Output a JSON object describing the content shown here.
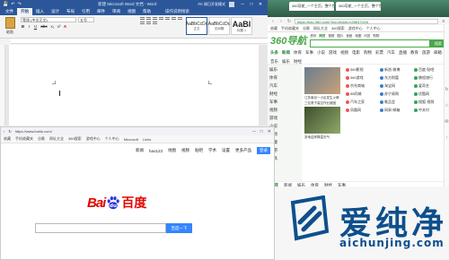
{
  "word": {
    "title": "新建 Microsoft Word 文档 - Word",
    "user": "PE 周日开发模式",
    "quick_access": [
      "💾",
      "↶",
      "↷"
    ],
    "window_controls": [
      "─",
      "□",
      "✕"
    ],
    "tabs": [
      "文件",
      "开始",
      "插入",
      "设计",
      "布局",
      "引用",
      "邮件",
      "审阅",
      "视图",
      "帮助"
    ],
    "active_tab": "开始",
    "tell_me": "操作说明搜索",
    "paste_label": "粘贴",
    "font_name": "等线 (中文正文)",
    "font_size": "五号",
    "format_buttons": [
      "B",
      "I",
      "U",
      "abc",
      "x₂",
      "x²",
      "A"
    ],
    "styles": [
      {
        "sample": "AaBbCcDc",
        "name": "正文"
      },
      {
        "sample": "AaBbCcDc",
        "name": "无间隔"
      },
      {
        "sample": "AaBl",
        "name": "标题 1"
      }
    ]
  },
  "nav360": {
    "tabs": [
      "360导航_一个主页，整个世界",
      "360导航_一个主页，整个世界"
    ],
    "url": "https://hao.360.com/?src=lm&ls=n35b47c1f4",
    "favorites": [
      "收藏",
      "手机收藏夹",
      "谷歌",
      "网址大全",
      "360搜索",
      "游戏中心",
      "个人中心"
    ],
    "logo": "360导航",
    "search_tabs": [
      "资讯",
      "网页",
      "视频",
      "图片",
      "良医",
      "地图",
      "问答",
      "购物"
    ],
    "search_button": "搜索",
    "categories": [
      "头条",
      "新闻",
      "体育",
      "军事",
      "小说",
      "游戏",
      "视频",
      "电影",
      "购物",
      "彩票",
      "汽车",
      "直播",
      "教育",
      "旅游",
      "邮箱",
      "音乐",
      "娱乐",
      "财经"
    ],
    "left_menu": [
      "娱乐",
      "体育",
      "汽车",
      "财经",
      "军事",
      "视频",
      "游戏",
      "小说",
      "购物",
      "健康",
      "旅游",
      "工具"
    ],
    "news": [
      "江苏南京一小区发生火情",
      "三名男子高空作业被困",
      "多地迎来降温天气"
    ],
    "sites": [
      "360影视",
      "新浪·微博",
      "百度·贴吧",
      "360游戏",
      "东方财富",
      "携程旅行",
      "京东商城",
      "淘宝网",
      "爱奇艺",
      "58同城",
      "苏宁易购",
      "优酷网",
      "汽车之家",
      "唯品会",
      "搜狐·视频",
      "凤凰网",
      "网易·邮箱",
      "中关村"
    ],
    "news_tabs": [
      "推荐",
      "新闻",
      "娱乐",
      "体育",
      "财经",
      "军事"
    ],
    "feed": [
      "最美太行 | 美丽壶关 石板路上的乡村",
      "2000元买不到暖笔记本？看这款就够了"
    ],
    "side_tools": [
      "↻",
      "☆",
      "✉",
      "↑"
    ]
  },
  "baidu": {
    "url": "https://www.baidu.com/",
    "search_text": "百度一下，你就知道",
    "window_controls": [
      "─",
      "□",
      "✕"
    ],
    "favorites": [
      "收藏",
      "手机收藏夹",
      "谷歌",
      "网址大全",
      "360搜索",
      "游戏中心",
      "个人中心",
      "Microsoft",
      "Links"
    ],
    "nav_links": [
      "新闻",
      "hao123",
      "地图",
      "视频",
      "贴吧",
      "学术",
      "登录",
      "设置",
      "更多产品"
    ],
    "login_button": "登录",
    "logo_left": "Bai",
    "logo_right": "百度",
    "search_button": "百度一下",
    "search_value": ""
  },
  "watermark": {
    "text": "爱纯净",
    "url": "aichunjing.com"
  }
}
